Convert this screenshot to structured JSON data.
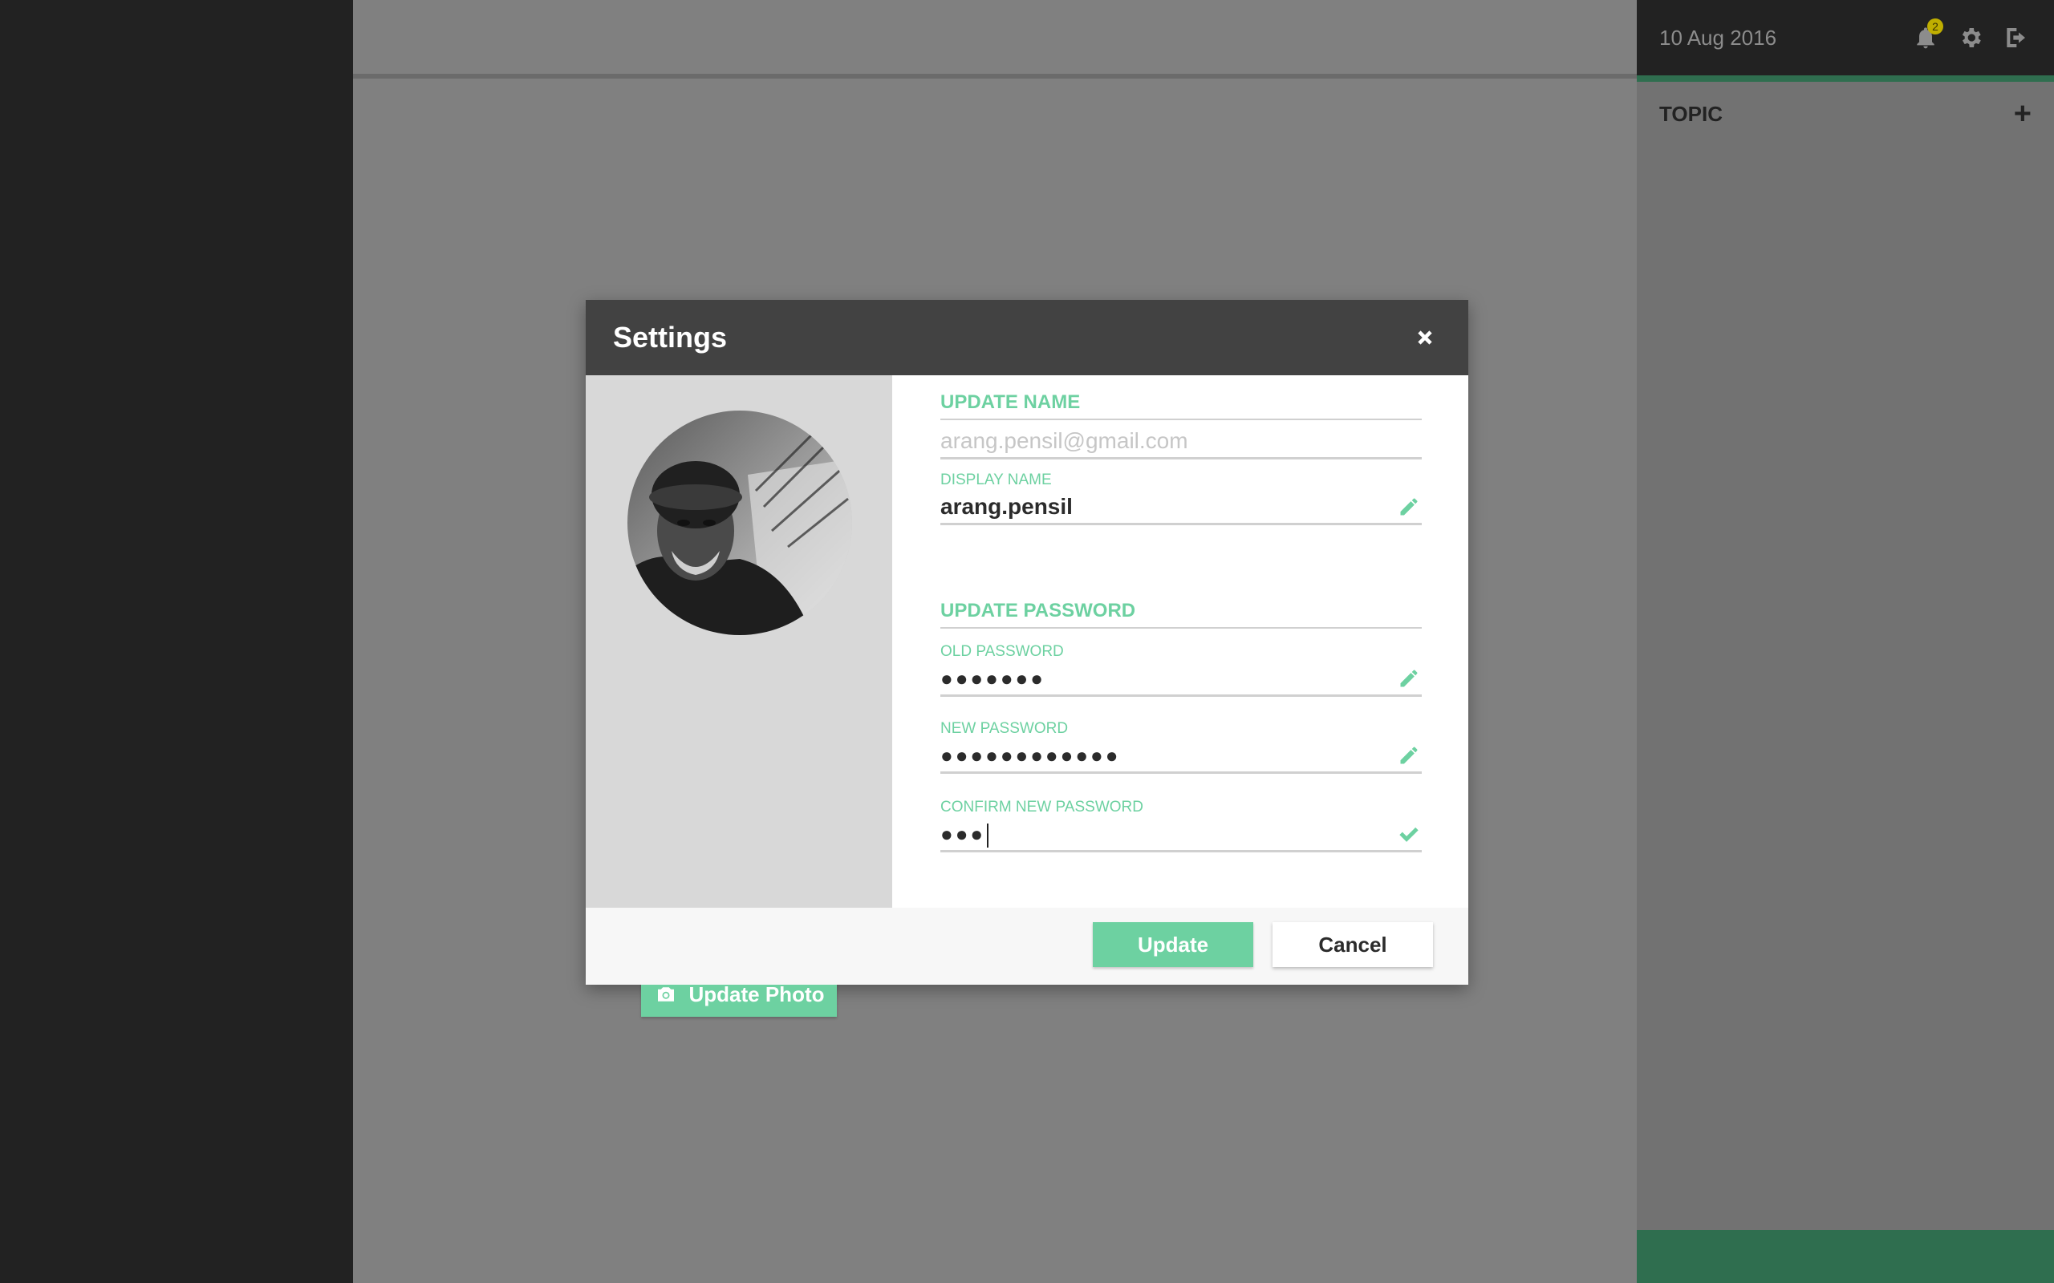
{
  "header": {
    "date": "10 Aug 2016",
    "notification_count": "2",
    "icons": [
      "bell-icon",
      "gear-icon",
      "logout-icon"
    ]
  },
  "right_panel": {
    "topic_title": "TOPIC",
    "add_icon": "plus-icon"
  },
  "modal": {
    "title": "Settings",
    "update_photo_label": "Update Photo",
    "update_name": {
      "section_title": "UPDATE NAME",
      "email_placeholder": "arang.pensil@gmail.com",
      "display_name_label": "DISPLAY NAME",
      "display_name_value": "arang.pensil"
    },
    "update_password": {
      "section_title": "UPDATE PASSWORD",
      "old_password_label": "OLD PASSWORD",
      "old_password_value": "●●●●●●●",
      "new_password_label": "NEW PASSWORD",
      "new_password_value": "●●●●●●●●●●●●",
      "confirm_password_label": "CONFIRM NEW PASSWORD",
      "confirm_password_value": "●●●"
    },
    "buttons": {
      "update": "Update",
      "cancel": "Cancel"
    }
  },
  "colors": {
    "accent": "#6dd1a1",
    "dark": "#222222",
    "modal_header": "#424242",
    "overlay": "#808080",
    "panel_green": "#2f6e4f"
  }
}
